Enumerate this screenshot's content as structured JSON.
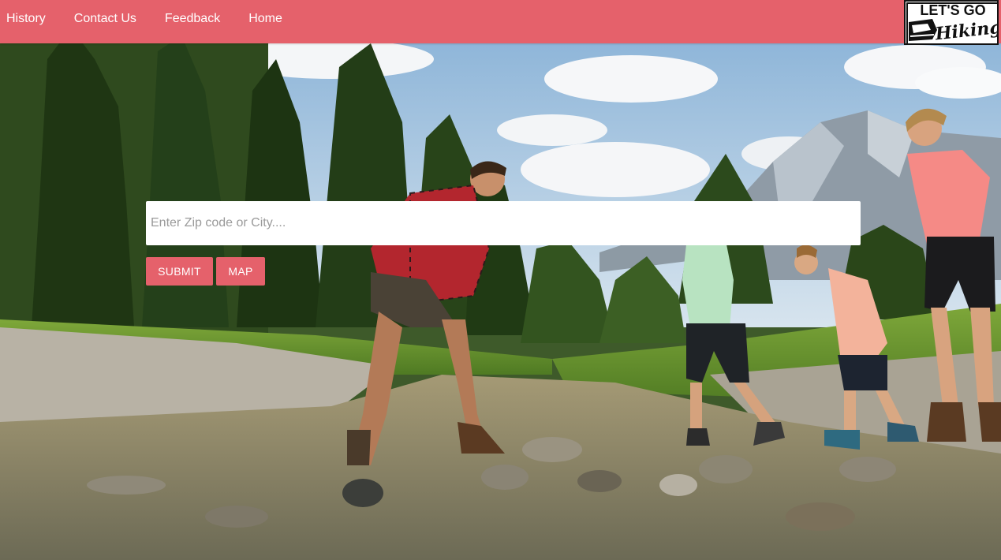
{
  "navbar": {
    "links": [
      {
        "label": "History"
      },
      {
        "label": "Contact Us"
      },
      {
        "label": "Feedback"
      },
      {
        "label": "Home"
      }
    ],
    "logo": {
      "line1": "LET'S GO",
      "line2": "Hiking"
    },
    "background_color": "#e5616b"
  },
  "search": {
    "placeholder": "Enter Zip code or City....",
    "value": ""
  },
  "buttons": {
    "submit_label": "SUBMIT",
    "map_label": "MAP"
  },
  "hero": {
    "image_description_icon": "mountain-river-hiking-family-photo"
  },
  "colors": {
    "accent": "#e5616b",
    "text_on_accent": "#ffffff"
  }
}
